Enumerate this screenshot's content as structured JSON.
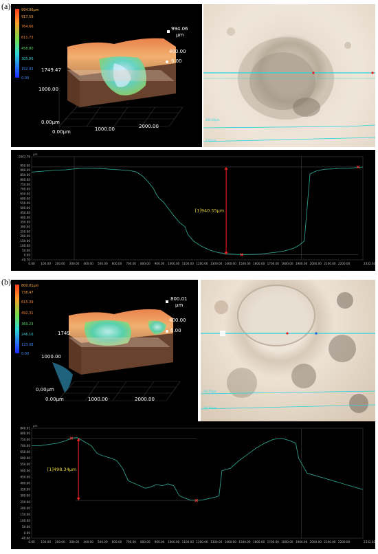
{
  "panels": [
    {
      "label": "(a)",
      "colorbar": {
        "ticks": [
          "994.06μm",
          "917.59",
          "764.66",
          "611.73",
          "458.80",
          "305.86",
          "152.93",
          "0.00"
        ]
      },
      "view3d": {
        "zmax": "994.06",
        "zunit": "μm",
        "z400": "400.00",
        "z0": "0.00",
        "y_far": "1749.47",
        "y_mid": "1000.00",
        "y_origin": "0.00μm",
        "x_origin": "0.00μm",
        "x_mid": "1000.00",
        "x_far": "2000.00"
      },
      "micro": {
        "scale1": "200.00μm",
        "scale2": "5.00μm"
      },
      "profile": {
        "unit": "μm",
        "ymax_label": "1043.76",
        "ymin_label": "-49.70",
        "x_end_label": "2332.63",
        "y_ticks": [
          "950.00",
          "900.00",
          "850.00",
          "800.00",
          "750.00",
          "700.00",
          "650.00",
          "600.00",
          "550.00",
          "500.00",
          "450.00",
          "400.00",
          "350.00",
          "300.00",
          "250.00",
          "200.00",
          "150.00",
          "100.00",
          "50.00",
          "0.00"
        ],
        "x_ticks": [
          "0.00",
          "100.00",
          "200.00",
          "300.00",
          "400.00",
          "500.00",
          "600.00",
          "700.00",
          "800.00",
          "900.00",
          "1000.00",
          "1100.00",
          "1200.00",
          "1300.00",
          "1400.00",
          "1500.00",
          "1600.00",
          "1700.00",
          "1800.00",
          "1900.00",
          "2000.00",
          "2100.00",
          "2200.00"
        ],
        "measurement": "[1]940.55μm",
        "ylim": [
          -49.7,
          1043.76
        ],
        "xlim": [
          0,
          2332.63
        ],
        "cursor_x": [
          1500,
          2300
        ],
        "markers": [
          [
            1480,
            5
          ],
          [
            2300,
            935
          ]
        ],
        "arrow_x": 1370,
        "arrow_y": [
          935,
          5
        ],
        "ref_x": [
          300,
          1900
        ],
        "x": [
          0,
          80,
          160,
          240,
          300,
          360,
          420,
          500,
          560,
          620,
          660,
          700,
          740,
          780,
          820,
          860,
          880,
          900,
          930,
          960,
          1000,
          1040,
          1080,
          1100,
          1140,
          1200,
          1260,
          1320,
          1380,
          1440,
          1480,
          1520,
          1600,
          1660,
          1720,
          1780,
          1840,
          1880,
          1920,
          1940,
          1960,
          2000,
          2060,
          2120,
          2180,
          2240,
          2300,
          2332
        ],
        "y": [
          880,
          890,
          900,
          905,
          915,
          920,
          920,
          918,
          910,
          905,
          900,
          895,
          880,
          840,
          780,
          700,
          640,
          600,
          560,
          500,
          420,
          350,
          300,
          220,
          150,
          90,
          50,
          25,
          15,
          8,
          5,
          6,
          10,
          20,
          30,
          45,
          70,
          100,
          150,
          500,
          860,
          890,
          910,
          915,
          920,
          920,
          930,
          935
        ]
      }
    },
    {
      "label": "(b)",
      "colorbar": {
        "ticks": [
          "800.01μm",
          "738.47",
          "615.39",
          "492.31",
          "369.23",
          "246.16",
          "123.08",
          "0.00"
        ]
      },
      "view3d": {
        "zmax": "800.01",
        "zunit": "μm",
        "z400": "400.00",
        "z0": "0.00",
        "y_far": "1749",
        "y_mid": "1000.00",
        "y_origin": "0.00μm",
        "x_origin": "0.00μm",
        "x_mid": "1000.00",
        "x_far": "2000.00"
      },
      "micro": {
        "scale1": "200.00μm",
        "scale2": "200.00μm"
      },
      "profile": {
        "unit": "μm",
        "ymax_label": "840.01",
        "ymin_label": "-40.00",
        "x_end_label": "2332.63",
        "y_ticks": [
          "800.00",
          "750.00",
          "700.00",
          "650.00",
          "600.00",
          "550.00",
          "500.00",
          "450.00",
          "400.00",
          "350.00",
          "300.00",
          "250.00",
          "200.00",
          "150.00",
          "100.00",
          "50.00",
          "0.00"
        ],
        "x_ticks": [
          "0.00",
          "100.00",
          "200.00",
          "300.00",
          "400.00",
          "500.00",
          "600.00",
          "700.00",
          "800.00",
          "900.00",
          "1000.00",
          "1100.00",
          "1200.00",
          "1300.00",
          "1400.00",
          "1500.00",
          "1600.00",
          "1700.00",
          "1800.00",
          "1900.00",
          "2000.00",
          "2100.00",
          "2200.00"
        ],
        "measurement": "[1]498.34μm",
        "ylim": [
          -40,
          840.01
        ],
        "xlim": [
          0,
          2332.63
        ],
        "cursor_x": [
          280,
          1160
        ],
        "markers": [
          [
            280,
            760
          ],
          [
            1160,
            262
          ]
        ],
        "arrow_x": 330,
        "arrow_y": [
          760,
          262
        ],
        "ref_x": [
          1900
        ],
        "x": [
          0,
          60,
          120,
          180,
          240,
          280,
          320,
          360,
          420,
          460,
          500,
          560,
          600,
          640,
          680,
          720,
          760,
          800,
          840,
          880,
          920,
          960,
          1000,
          1040,
          1080,
          1120,
          1160,
          1200,
          1260,
          1300,
          1320,
          1340,
          1400,
          1460,
          1520,
          1580,
          1640,
          1700,
          1760,
          1820,
          1860,
          1880,
          1900,
          1940,
          2000,
          2060,
          2120,
          2180,
          2240,
          2300,
          2332
        ],
        "y": [
          700,
          700,
          710,
          720,
          740,
          760,
          765,
          740,
          700,
          640,
          620,
          600,
          580,
          520,
          420,
          400,
          380,
          360,
          370,
          390,
          380,
          395,
          380,
          300,
          280,
          265,
          262,
          265,
          280,
          290,
          300,
          500,
          520,
          580,
          630,
          680,
          720,
          750,
          760,
          740,
          720,
          600,
          560,
          480,
          460,
          440,
          420,
          400,
          380,
          360,
          350
        ]
      }
    }
  ]
}
